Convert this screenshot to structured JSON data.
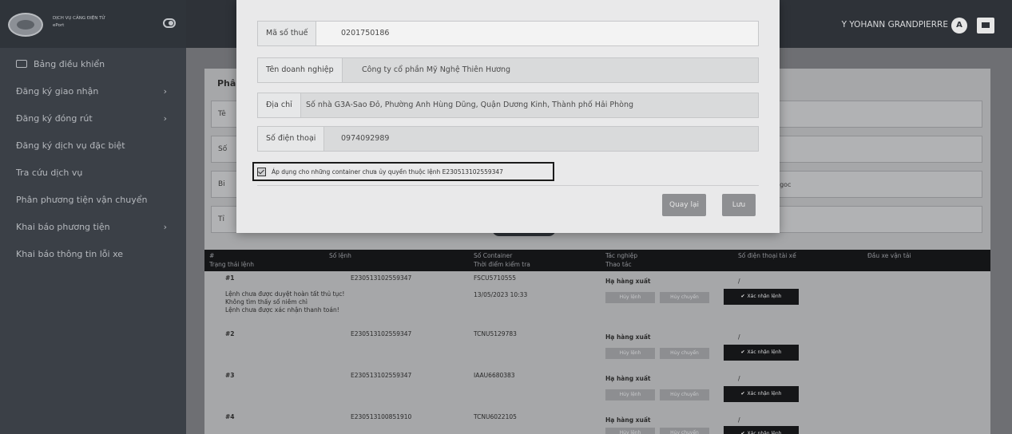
{
  "brand": {
    "line1": "DỊCH VỤ CẢNG ĐIỆN TỬ",
    "line2": "ePort"
  },
  "sidebar": {
    "items": [
      {
        "label": "Bảng điều khiển",
        "icon": "monitor-icon",
        "has_chevron": false
      },
      {
        "label": "Đăng ký giao nhận",
        "has_chevron": true
      },
      {
        "label": "Đăng ký đóng rút",
        "has_chevron": true
      },
      {
        "label": "Đăng ký dịch vụ đặc biệt",
        "has_chevron": false
      },
      {
        "label": "Tra cứu dịch vụ",
        "has_chevron": false
      },
      {
        "label": "Phân phương tiện vận chuyển",
        "has_chevron": false
      },
      {
        "label": "Khai báo phương tiện",
        "has_chevron": true
      },
      {
        "label": "Khai báo thông tin lỗi xe",
        "has_chevron": false
      }
    ],
    "chevron": "›"
  },
  "topbar": {
    "user_name": "Y YOHANN GRANDPIERRE",
    "avatar_letter": "A"
  },
  "background_page": {
    "title": "Phâ",
    "field_stubs": [
      "Tê",
      "Số",
      "Bi",
      "Tỉ"
    ],
    "right_stub": "ngoc",
    "table": {
      "headers": [
        {
          "top": "#",
          "bottom": "Trạng thái lệnh"
        },
        {
          "top": "Số lệnh",
          "bottom": ""
        },
        {
          "top": "Số Container",
          "bottom": "Thời điểm kiểm tra"
        },
        {
          "top": "Tác nghiệp",
          "bottom": "Thao tác"
        },
        {
          "top": "Số điện thoại tài xế",
          "bottom": ""
        },
        {
          "top": "Đầu xe vận tải",
          "bottom": ""
        }
      ],
      "rows": [
        {
          "index": "#1",
          "order_no": "E230513102559347",
          "container": "FSCU5710555",
          "time": "13/05/2023 10:33",
          "operation": "Hạ hàng xuất",
          "phone": "/",
          "issues": [
            "Lệnh chưa được duyệt hoàn tất thủ tục!",
            "Không tìm thấy số niêm chì",
            "Lệnh chưa được xác nhận thanh toán!"
          ]
        },
        {
          "index": "#2",
          "order_no": "E230513102559347",
          "container": "TCNU5129783",
          "time": "",
          "operation": "Hạ hàng xuất",
          "phone": "/",
          "issues": []
        },
        {
          "index": "#3",
          "order_no": "E230513102559347",
          "container": "IAAU6680383",
          "time": "",
          "operation": "Hạ hàng xuất",
          "phone": "/",
          "issues": []
        },
        {
          "index": "#4",
          "order_no": "E230513100851910",
          "container": "TCNU6022105",
          "time": "",
          "operation": "Hạ hàng xuất",
          "phone": "/",
          "issues": []
        }
      ],
      "action_labels": [
        "Hủy lệnh",
        "Hủy chuyến"
      ],
      "confirm_label": "Xác nhận lệnh",
      "confirm_check": "✔"
    }
  },
  "modal": {
    "fields": [
      {
        "label": "Mã số thuế",
        "value": "0201750186"
      },
      {
        "label": "Tên doanh nghiệp",
        "value": "Công ty cổ phần Mỹ Nghệ Thiên Hương"
      },
      {
        "label": "Địa chỉ",
        "value": "Số nhà G3A-Sao Đỏ, Phường Anh Hùng Dũng, Quận Dương Kinh, Thành phố Hải Phòng"
      },
      {
        "label": "Số điện thoại",
        "value": "0974092989"
      }
    ],
    "checkbox_label": "Áp dụng cho những container chưa ủy quyền thuộc lệnh E230513102559347",
    "checkbox_checked": true,
    "back_label": "Quay lại",
    "save_label": "Lưu"
  },
  "colors": {
    "sidebar_bg": "#3b4047",
    "topbar_bg": "#2e3238",
    "table_header_bg": "#141517",
    "modal_bg": "#e9e9ea",
    "button_gray": "#8e8f92",
    "highlight_border": "#1b1b1b"
  }
}
